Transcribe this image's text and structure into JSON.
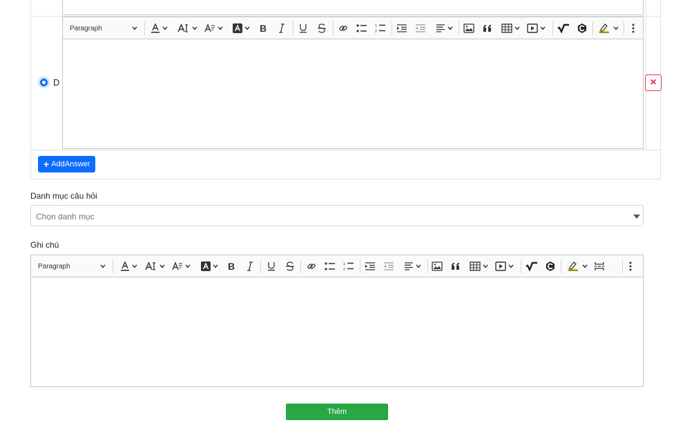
{
  "answer": {
    "option_label": "D",
    "delete_symbol": "×",
    "add_answer_label": "AddAnswer",
    "add_symbol": "+"
  },
  "editor_toolbar": {
    "heading_label": "Paragraph"
  },
  "category": {
    "label": "Danh mục câu hỏi",
    "placeholder": "Chọn danh mục"
  },
  "notes": {
    "label": "Ghi chú"
  },
  "submit_label": "Thêm",
  "colors": {
    "primary": "#0d6efd",
    "danger": "#dc3545",
    "success": "#28a745",
    "border": "#c4c4c4"
  }
}
